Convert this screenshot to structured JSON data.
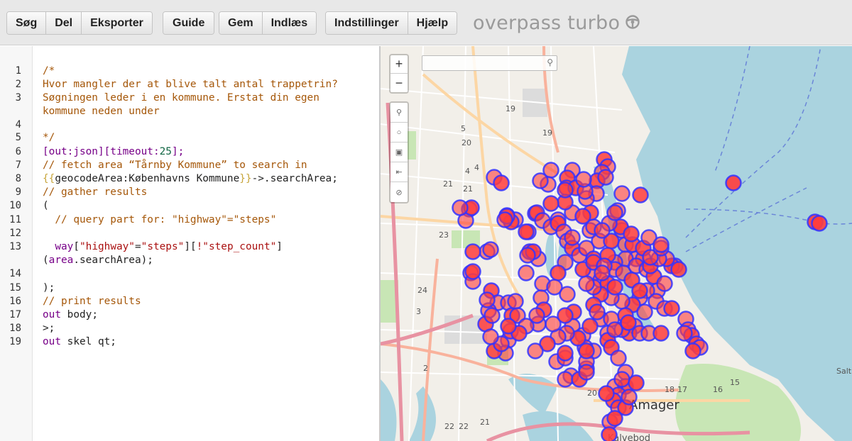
{
  "toolbar": {
    "groups": [
      [
        "Søg",
        "Del",
        "Eksporter"
      ],
      [
        "Guide"
      ],
      [
        "Gem",
        "Indlæs"
      ],
      [
        "Indstillinger",
        "Hjælp"
      ]
    ],
    "brand": "overpass turbo",
    "brand_icon": "steering-wheel-icon"
  },
  "editor": {
    "line_numbers": [
      "1",
      "2",
      "3",
      "",
      "4",
      "5",
      "6",
      "7",
      "8",
      "9",
      "10",
      "11",
      "12",
      "13",
      "",
      "14",
      "15",
      "16",
      "17",
      "18",
      "19"
    ],
    "lines": {
      "l1": "/*",
      "l2": "Hvor mangler der at blive talt antal trappetrin?",
      "l3a": "Søgningen leder i en kommune. Erstat din egen",
      "l3b": "kommune neden under",
      "l5": "*/",
      "l6_a": "[out:json][timeout:",
      "l6_num": "25",
      "l6_b": "];",
      "l7": "// fetch area “Tårnby Kommune” to search in",
      "l8_open": "{{",
      "l8_mid": "geocodeArea:Københavns Kommune",
      "l8_close": "}}",
      "l8_rest": "->.searchArea;",
      "l9": "// gather results",
      "l10": "(",
      "l11": "  // query part for: \"highway\"=\"steps\"",
      "l13_kw": "  way",
      "l13_a": "[",
      "l13_s1": "\"highway\"",
      "l13_eq": "=",
      "l13_s2": "\"steps\"",
      "l13_b": "][",
      "l13_s3": "!\"step_count\"",
      "l13_c": "]",
      "l13w_a": "(",
      "l13w_kw": "area",
      "l13w_b": ".searchArea);",
      "l15": ");",
      "l16": "// print results",
      "l17_kw": "out",
      "l17_rest": " body;",
      "l18": ">;",
      "l19_kw": "out",
      "l19_rest": " skel qt;"
    }
  },
  "map": {
    "search_placeholder": "",
    "zoom_in": "+",
    "zoom_out": "−",
    "controls": [
      "search-icon",
      "locate-icon",
      "image-icon",
      "fit-data-icon",
      "clear-icon"
    ],
    "labels": {
      "amager": "Amager",
      "kalvebod": "Kalvebod",
      "salt": "Salt",
      "route_numbers": [
        "19",
        "19",
        "5",
        "4",
        "20",
        "21",
        "21",
        "23",
        "24",
        "3",
        "2",
        "17",
        "16",
        "15",
        "18",
        "20",
        "22",
        "22",
        "21",
        "4"
      ]
    },
    "colors": {
      "marker_fill": "#ff3c3c",
      "marker_stroke": "#3333ff",
      "water": "#aad3df",
      "land": "#f2efe9",
      "park": "#c8e6b5",
      "motorway": "#e892a2",
      "trunk": "#f9b29c",
      "primary": "#fcd6a4"
    }
  }
}
